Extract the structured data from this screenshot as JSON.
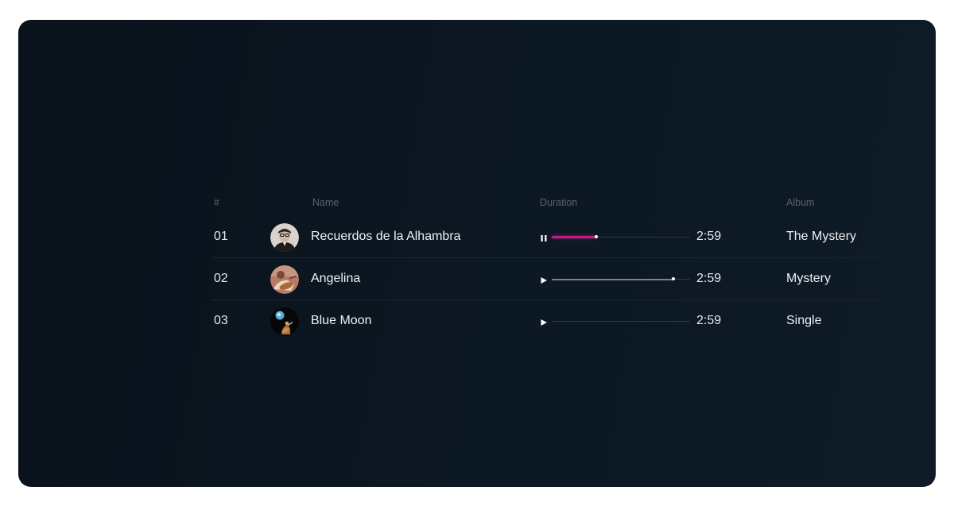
{
  "table": {
    "headers": {
      "number": "#",
      "name": "Name",
      "duration": "Duration",
      "album": "Album"
    },
    "rows": [
      {
        "number": "01",
        "title": "Recuerdos de la Alhambra",
        "duration": "2:59",
        "album": "The Mystery",
        "state": "playing",
        "control_icon": "pause-icon",
        "progress": 0.32,
        "progress_color": "#c41b85"
      },
      {
        "number": "02",
        "title": "Angelina",
        "duration": "2:59",
        "album": "Mystery",
        "state": "paused",
        "control_icon": "play-icon",
        "progress": 0.88,
        "progress_color": "#7a848f"
      },
      {
        "number": "03",
        "title": "Blue Moon",
        "duration": "2:59",
        "album": "Single",
        "state": "stopped",
        "control_icon": "play-icon",
        "progress": 0,
        "progress_color": "#7a848f"
      }
    ]
  },
  "colors": {
    "background": "#0c1620",
    "accent": "#c41b85",
    "text": "#eef1f4",
    "header_text": "#59626d",
    "divider": "#1b2531"
  }
}
